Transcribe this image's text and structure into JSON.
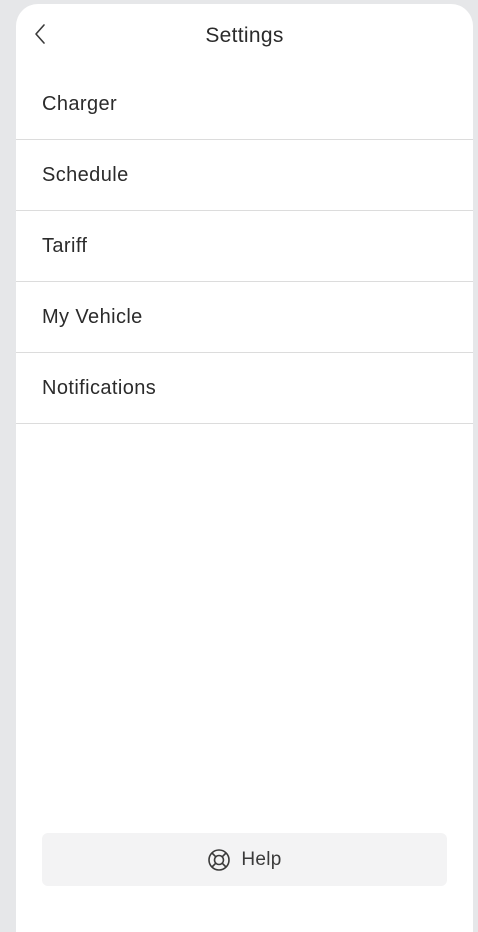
{
  "header": {
    "title": "Settings",
    "back_icon": "chevron-left-icon"
  },
  "menu": {
    "items": [
      {
        "label": "Charger"
      },
      {
        "label": "Schedule"
      },
      {
        "label": "Tariff"
      },
      {
        "label": "My Vehicle"
      },
      {
        "label": "Notifications"
      }
    ]
  },
  "help": {
    "label": "Help",
    "icon": "lifebuoy-icon"
  },
  "colors": {
    "background": "#e6e7e9",
    "surface": "#ffffff",
    "divider": "#dcdcdc",
    "help_button": "#f3f3f4",
    "text": "#2b2b2b"
  }
}
